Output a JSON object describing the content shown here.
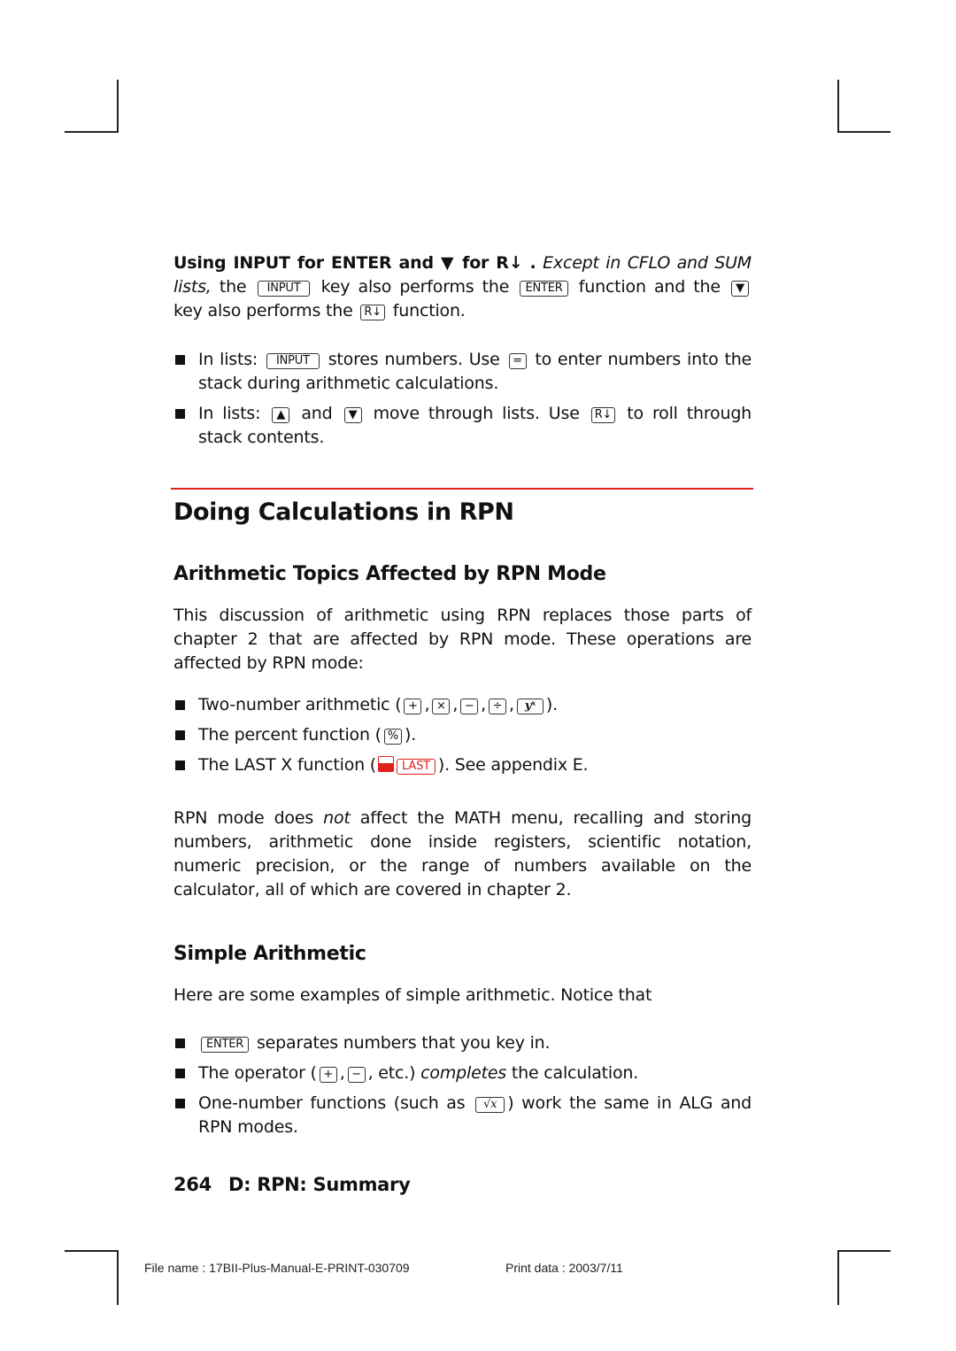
{
  "intro": {
    "bold_lead": "Using INPUT for ENTER and ▼ for R↓ .",
    "italic_lead": "Except in CFLO and SUM lists,",
    "t1": "the",
    "key_input": "INPUT",
    "t2": "key also performs the",
    "key_enter": "ENTER",
    "t3": "function and the",
    "key_down": "▼",
    "t4": "key also performs the",
    "key_rdown": "R↓",
    "t5": "function."
  },
  "list_bullets": [
    {
      "a": "In lists:",
      "key1": "INPUT",
      "b": "stores numbers. Use",
      "key2": "=",
      "c": "to enter numbers into the stack during arithmetic calculations."
    },
    {
      "a": "In lists:",
      "key1": "▲",
      "b": "and",
      "key2": "▼",
      "c": "move through lists. Use",
      "key3": "R↓",
      "d": "to roll through stack contents."
    }
  ],
  "section_title": "Doing Calculations in RPN",
  "sub1": {
    "title": "Arithmetic Topics Affected by RPN Mode",
    "para": "This discussion of arithmetic using RPN replaces those parts of chapter 2 that are affected by RPN mode. These operations are affected by RPN mode:",
    "bullets": [
      {
        "text": "Two-number arithmetic (",
        "keys": [
          "+",
          "×",
          "−",
          "÷",
          "yˣ"
        ],
        "end": ")."
      },
      {
        "text": "The percent function (",
        "keys": [
          "%"
        ],
        "end": ")."
      },
      {
        "text": "The LAST X function (",
        "keys": [
          "LAST"
        ],
        "end": "). See appendix E."
      }
    ],
    "para2_a": "RPN mode does",
    "para2_em": "not",
    "para2_b": "affect the MATH menu, recalling and storing numbers, arithmetic done inside registers, scientific notation, numeric precision, or the range of numbers available on the calculator, all of which are covered in chapter 2."
  },
  "sub2": {
    "title": "Simple Arithmetic",
    "para": "Here are some examples of simple arithmetic. Notice that",
    "b1_key": "ENTER",
    "b1_text": "separates numbers that you key in.",
    "b2_a": "The operator (",
    "b2_k1": "+",
    "b2_k2": "−",
    "b2_b": ", etc.)",
    "b2_em": "completes",
    "b2_c": "the calculation.",
    "b3_a": "One-number functions (such as",
    "b3_key": "√x",
    "b3_b": ") work the same in ALG and RPN modes."
  },
  "page_footer": {
    "page": "264",
    "section": "D: RPN: Summary"
  },
  "print_info": {
    "file": "File name : 17BII-Plus-Manual-E-PRINT-030709",
    "date": "Print data : 2003/7/11"
  },
  "colors": {
    "accent": "#e0201b"
  }
}
